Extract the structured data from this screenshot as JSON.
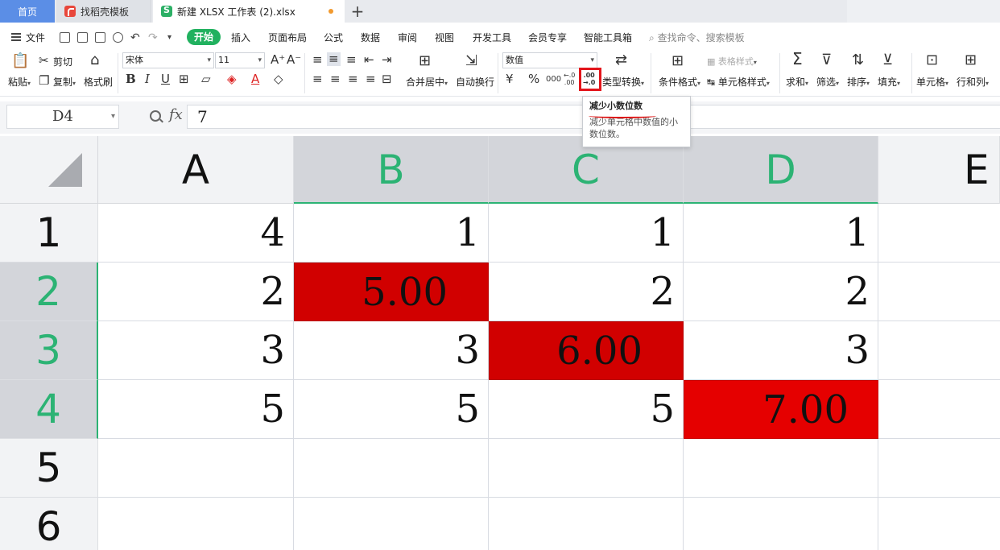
{
  "tabs": {
    "home": "首页",
    "templates": "找稻壳模板",
    "file": "新建 XLSX 工作表 (2).xlsx",
    "new_tab": "+"
  },
  "menu": {
    "file": "文件",
    "active": "开始",
    "items": [
      "插入",
      "页面布局",
      "公式",
      "数据",
      "审阅",
      "视图",
      "开发工具",
      "会员专享",
      "智能工具箱"
    ],
    "search_placeholder": "查找命令、搜索模板"
  },
  "ribbon": {
    "paste": "粘贴",
    "cut": "剪切",
    "copy": "复制",
    "format_painter": "格式刷",
    "font_name": "宋体",
    "font_size": "11",
    "bold": "B",
    "italic": "I",
    "underline": "U",
    "merge_center": "合并居中",
    "wrap": "自动换行",
    "number_format": "数值",
    "currency": "¥",
    "percent": "%",
    "thousands": "000",
    "inc_decimal_top": "←.0",
    "inc_decimal_bottom": ".00",
    "dec_decimal_top": ".00",
    "dec_decimal_bottom": "→.0",
    "type_convert": "类型转换",
    "cond_format": "条件格式",
    "table_style": "表格样式",
    "cell_style": "单元格样式",
    "sum": "求和",
    "filter": "筛选",
    "sort": "排序",
    "fill": "填充",
    "cell": "单元格",
    "row_col": "行和列"
  },
  "tooltip": {
    "title": "减少小数位数",
    "description": "减少单元格中数值的小数位数。"
  },
  "formula_bar": {
    "name_box": "D4",
    "fx": "fx",
    "value": "7"
  },
  "sheet": {
    "columns": [
      "A",
      "B",
      "C",
      "D",
      "E"
    ],
    "rows": [
      "1",
      "2",
      "3",
      "4",
      "5",
      "6"
    ],
    "cells": [
      [
        "4",
        "1",
        "1",
        "1"
      ],
      [
        "2",
        "5.00",
        "2",
        "2"
      ],
      [
        "3",
        "3",
        "6.00",
        "3"
      ],
      [
        "5",
        "5",
        "5",
        "7.00"
      ]
    ],
    "highlight_color": "#d10000",
    "selection_color": "#2cb374"
  }
}
